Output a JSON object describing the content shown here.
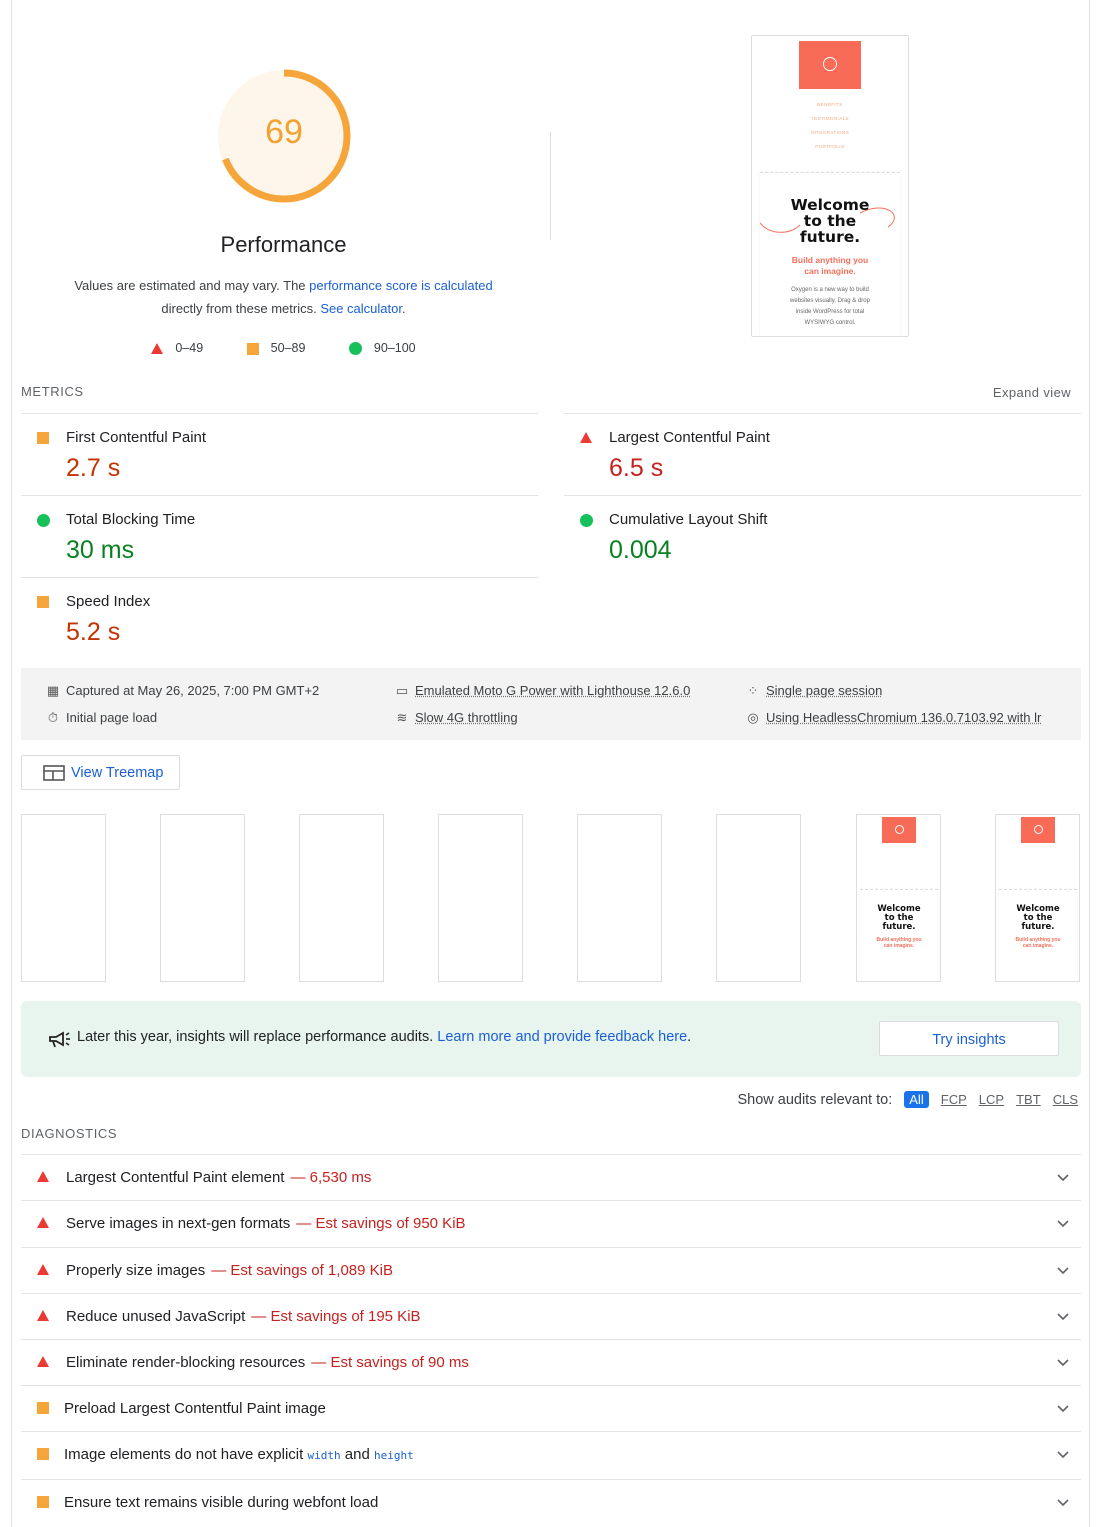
{
  "gauge": {
    "score": "69",
    "title": "Performance",
    "fraction": 0.69,
    "color": "#f2a230"
  },
  "desc": {
    "part1": "Values are estimated and may vary. The ",
    "link1": "performance score is calculated",
    "part2": " directly from these metrics. ",
    "link2": "See calculator",
    "part3": "."
  },
  "legend": {
    "fail": "0–49",
    "average": "50–89",
    "pass": "90–100"
  },
  "thumb": {
    "nav": [
      "BENEFITS",
      "TESTIMONIALS",
      "INTEGRATIONS",
      "PORTFOLIO"
    ],
    "welcome": [
      "Welcome",
      "to the",
      "future."
    ],
    "sub": [
      "Build anything you",
      "can imagine."
    ],
    "body": [
      "Oxygen is a new way to build",
      "websites visually. Drag & drop",
      "inside WordPress for total",
      "WYSIWYG control."
    ]
  },
  "metrics": {
    "header": "METRICS",
    "expand": "Expand view",
    "items": [
      {
        "name": "First Contentful Paint",
        "value": "2.7 s",
        "rating": "average"
      },
      {
        "name": "Largest Contentful Paint",
        "value": "6.5 s",
        "rating": "fail"
      },
      {
        "name": "Total Blocking Time",
        "value": "30 ms",
        "rating": "pass"
      },
      {
        "name": "Cumulative Layout Shift",
        "value": "0.004",
        "rating": "pass"
      },
      {
        "name": "Speed Index",
        "value": "5.2 s",
        "rating": "average"
      }
    ]
  },
  "env": {
    "captured": "Captured at May 26, 2025, 7:00 PM GMT+2",
    "load": "Initial page load",
    "device": "Emulated Moto G Power with Lighthouse 12.6.0",
    "throttle": "Slow 4G throttling",
    "session": "Single page session",
    "browser": "Using HeadlessChromium 136.0.7103.92 with lr"
  },
  "treemap": "View Treemap",
  "insights": {
    "text": "Later this year, insights will replace performance audits. ",
    "link": "Learn more and provide feedback here",
    "tail": ".",
    "button": "Try insights"
  },
  "filter": {
    "label": "Show audits relevant to:",
    "chips": [
      "All",
      "FCP",
      "LCP",
      "TBT",
      "CLS"
    ]
  },
  "diagnostics": {
    "header": "DIAGNOSTICS",
    "items": [
      {
        "title": "Largest Contentful Paint element",
        "savings": "— 6,530 ms",
        "rating": "fail"
      },
      {
        "title": "Serve images in next-gen formats",
        "savings": "— Est savings of 950 KiB",
        "rating": "fail"
      },
      {
        "title": "Properly size images",
        "savings": "— Est savings of 1,089 KiB",
        "rating": "fail"
      },
      {
        "title": "Reduce unused JavaScript",
        "savings": "— Est savings of 195 KiB",
        "rating": "fail"
      },
      {
        "title": "Eliminate render-blocking resources",
        "savings": "— Est savings of 90 ms",
        "rating": "fail"
      },
      {
        "title": "Preload Largest Contentful Paint image",
        "savings": "",
        "rating": "average"
      }
    ],
    "img_item": {
      "pre": "Image elements do not have explicit ",
      "code1": "width",
      "mid": " and ",
      "code2": "height"
    },
    "font_item": "Ensure text remains visible during webfont load"
  }
}
